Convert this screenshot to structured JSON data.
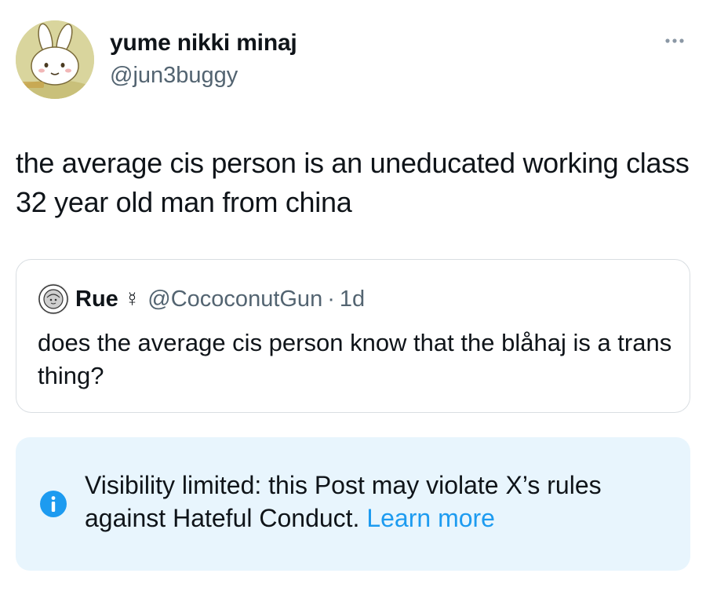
{
  "author": {
    "display_name": "yume nikki minaj",
    "handle": "@jun3buggy",
    "avatar_icon": "bunny-avatar-icon"
  },
  "menu": {
    "more_icon": "more-options-icon"
  },
  "tweet": {
    "text": "the average cis person is an uneducated working class 32 year old man from china"
  },
  "quote": {
    "name": "Rue",
    "name_glyph": "☿",
    "handle": "@CococonutGun",
    "separator": "·",
    "time": "1d",
    "text": "does the average cis person know that the blåhaj is a trans thing?"
  },
  "notice": {
    "text": "Visibility limited: this Post may violate X’s rules against Hateful Conduct.",
    "link": "Learn more",
    "icon": "info-icon"
  },
  "colors": {
    "text": "#0f1419",
    "secondary": "#536471",
    "accent": "#1d9bf0",
    "notice_bg": "#e8f5fd",
    "border": "#d9dee2"
  }
}
